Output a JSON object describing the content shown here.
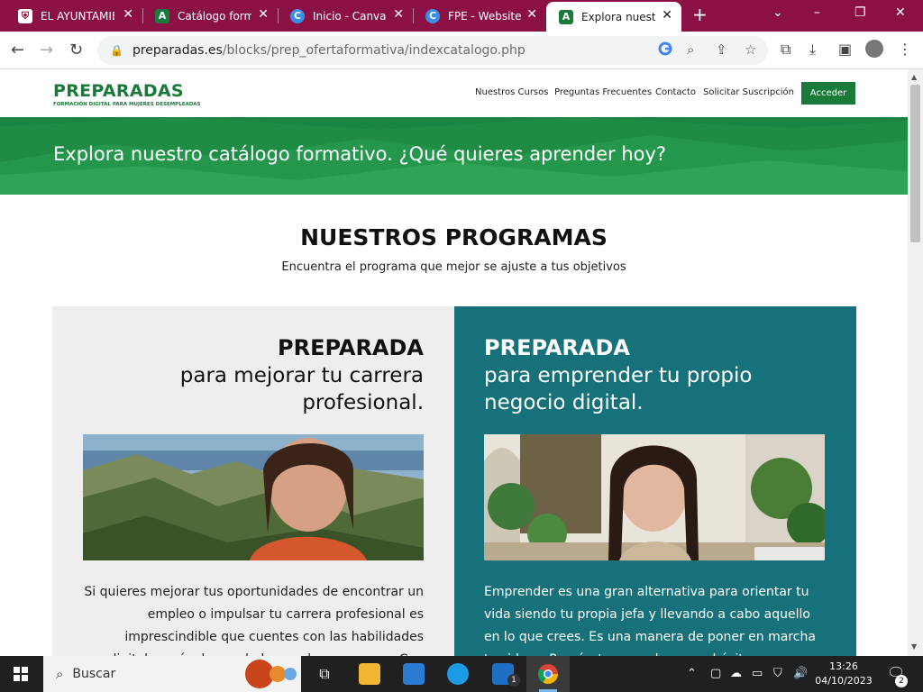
{
  "browser": {
    "tabs": [
      {
        "label": "EL AYUNTAMIE",
        "favicon": "municipal-shield-icon",
        "active": false
      },
      {
        "label": "Catálogo forma",
        "favicon": "preparadas-a-icon",
        "active": false
      },
      {
        "label": "Inicio - Canva",
        "favicon": "canva-icon",
        "active": false
      },
      {
        "label": "FPE - Website",
        "favicon": "canva-icon",
        "active": false
      },
      {
        "label": "Explora nuestro",
        "favicon": "preparadas-a-icon",
        "active": true
      }
    ],
    "url_domain": "preparadas.es",
    "url_path": "/blocks/prep_ofertaformativa/indexcatalogo.php"
  },
  "site": {
    "logo_text": "PREPARADAS",
    "logo_tagline": "FORMACIÓN DIGITAL PARA MUJERES DESEMPLEADAS",
    "nav": [
      "Nuestros Cursos",
      "Preguntas Frecuentes",
      "Contacto",
      "Solicitar Suscripción"
    ],
    "login_label": "Acceder",
    "hero_title": "Explora nuestro catálogo formativo. ¿Qué quieres aprender hoy?",
    "section_title": "NUESTROS PROGRAMAS",
    "section_subtitle": "Encuentra el programa que mejor se ajuste a tus objetivos",
    "programs": [
      {
        "title": "PREPARADA",
        "subtitle_line1": "para mejorar tu carrera",
        "subtitle_line2": "profesional.",
        "body": "Si quieres mejorar tus oportunidades de encontrar un empleo o impulsar tu carrera profesional es imprescindible que cuentes con las habilidades digitales más demandadas por las empresas. Con"
      },
      {
        "title": "PREPARADA",
        "subtitle_line1": "para emprender tu propio",
        "subtitle_line2": "negocio digital.",
        "body": "Emprender es una gran alternativa para orientar tu vida siendo tu propia jefa y llevando a cabo aquello en lo que crees. Es una manera de poner en marcha tus ideas. Prepárate para alcanzar el éxito profesional en tu"
      }
    ]
  },
  "taskbar": {
    "search_label": "Buscar",
    "mail_badge": "1",
    "notif_badge": "2",
    "time": "13:26",
    "date": "04/10/2023"
  },
  "colors": {
    "chrome_frame": "#8b1144",
    "brand_green": "#1a7a3a",
    "hero_green": "#1f8c46",
    "teal_card": "#16717a",
    "grey_card": "#eeeeee"
  }
}
